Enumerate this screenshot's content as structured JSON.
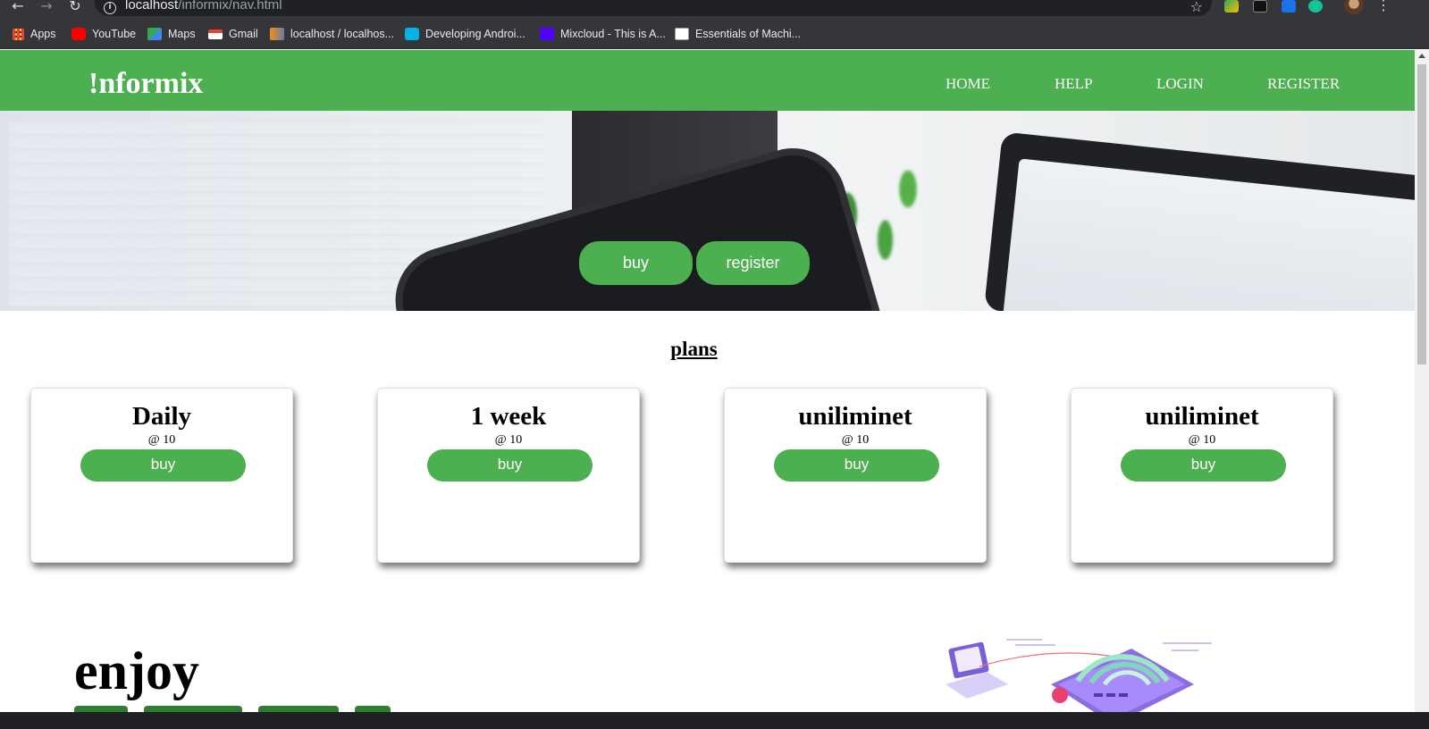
{
  "browser": {
    "url_host": "localhost",
    "url_path": "/informix/nav.html",
    "bookmarks": [
      {
        "label": "Apps",
        "color": "#ea4335"
      },
      {
        "label": "YouTube",
        "color": "#ff0000"
      },
      {
        "label": "Maps",
        "color": "#34a853"
      },
      {
        "label": "Gmail",
        "color": "#ea4335"
      },
      {
        "label": "localhost / localhos...",
        "color": "#f29111"
      },
      {
        "label": "Developing Androi...",
        "color": "#02b3e4"
      },
      {
        "label": "Mixcloud - This is A...",
        "color": "#5000ff"
      },
      {
        "label": "Essentials of Machi...",
        "color": "#ffffff"
      }
    ]
  },
  "site": {
    "brand": "!nformix",
    "menu": [
      "HOME",
      "HELP",
      "LOGIN",
      "REGISTER"
    ],
    "accent_color": "#4caf50"
  },
  "hero": {
    "buttons": [
      "buy",
      "register"
    ]
  },
  "plans": {
    "title": "plans",
    "cards": [
      {
        "title": "Daily",
        "price": "@ 10",
        "button": "buy"
      },
      {
        "title": "1 week",
        "price": "@ 10",
        "button": "buy"
      },
      {
        "title": "uniliminet",
        "price": "@ 10",
        "button": "buy"
      },
      {
        "title": "uniliminet",
        "price": "@ 10",
        "button": "buy"
      }
    ]
  },
  "promo": {
    "heading": "enjoy"
  }
}
